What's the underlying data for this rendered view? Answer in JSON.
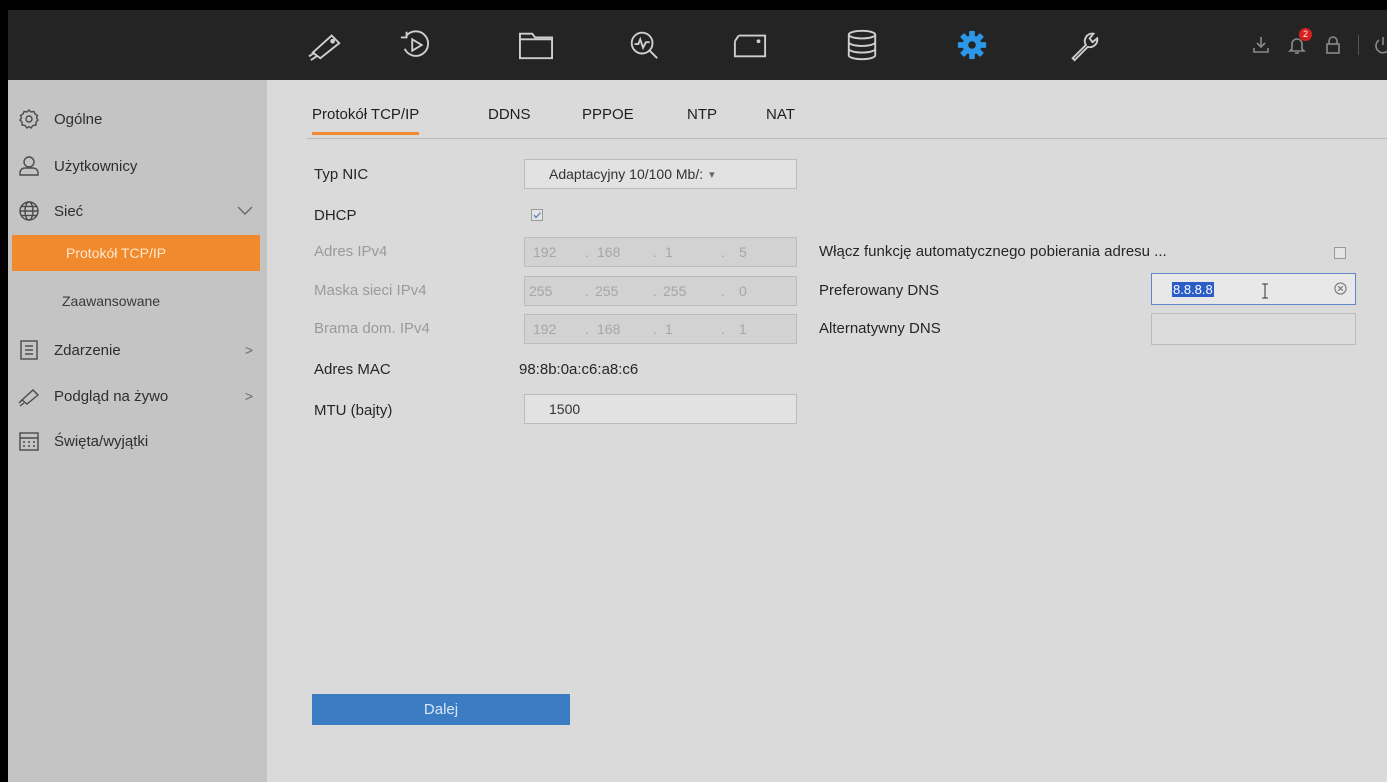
{
  "topbar": {
    "icons": [
      "live-view-camera-icon",
      "playback-icon",
      "file-management-icon",
      "smart-analysis-icon",
      "monitor-icon",
      "storage-icon",
      "configuration-gear-icon",
      "maintenance-wrench-icon"
    ],
    "active_icon": "configuration-gear-icon",
    "right_icons": [
      "download-icon",
      "alarm-bell-icon",
      "lock-icon",
      "power-icon"
    ],
    "alarm_count": "2",
    "accent": "#2c97e8"
  },
  "sidebar": {
    "items": [
      {
        "label": "Ogólne",
        "icon": "gear-outline-icon"
      },
      {
        "label": "Użytkownicy",
        "icon": "user-icon"
      },
      {
        "label": "Sieć",
        "icon": "globe-icon"
      },
      {
        "label": "Zdarzenie",
        "icon": "event-list-icon"
      },
      {
        "label": "Podgląd na żywo",
        "icon": "camera-icon"
      },
      {
        "label": "Święta/wyjątki",
        "icon": "calendar-icon"
      }
    ],
    "sub_items": [
      {
        "label": "Protokół TCP/IP",
        "active": true
      },
      {
        "label": "Zaawansowane",
        "active": false
      }
    ],
    "accent": "#f08a2c"
  },
  "tabs": [
    "Protokół TCP/IP",
    "DDNS",
    "PPPOE",
    "NTP",
    "NAT"
  ],
  "form": {
    "nic_type_label": "Typ NIC",
    "nic_type_value": "Adaptacyjny 10/100 Mb/:",
    "dhcp_label": "DHCP",
    "dhcp_checked": true,
    "ipv4_label": "Adres IPv4",
    "ipv4": [
      "192",
      "168",
      "1",
      "5"
    ],
    "mask_label": "Maska sieci IPv4",
    "mask": [
      "255",
      "255",
      "255",
      "0"
    ],
    "gateway_label": "Brama dom. IPv4",
    "gateway": [
      "192",
      "168",
      "1",
      "1"
    ],
    "mac_label": "Adres MAC",
    "mac_value": "98:8b:0a:c6:a8:c6",
    "mtu_label": "MTU (bajty)",
    "mtu_value": "1500",
    "auto_dns_label": "Włącz funkcję automatycznego pobierania adresu ...",
    "auto_dns_checked": false,
    "pref_dns_label": "Preferowany DNS",
    "pref_dns_value": "8.8.8.8",
    "alt_dns_label": "Alternatywny DNS",
    "alt_dns_value": "",
    "next_button": "Dalej"
  }
}
